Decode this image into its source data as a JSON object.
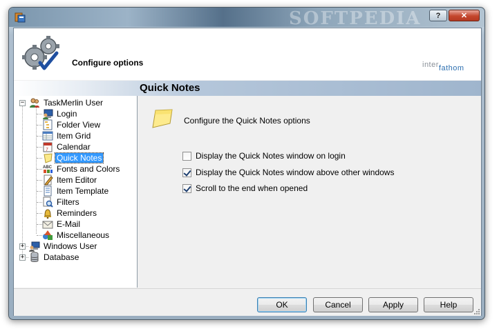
{
  "window": {
    "watermark": "SOFTPEDIA",
    "help_glyph": "?",
    "close_glyph": "✕"
  },
  "header": {
    "title": "Configure options",
    "brand_part1": "inter",
    "brand_part2": "fathom"
  },
  "banner": {
    "title": "Quick Notes"
  },
  "tree": {
    "root": "TaskMerlin User",
    "children": [
      "Login",
      "Folder View",
      "Item Grid",
      "Calendar",
      "Quick Notes",
      "Fonts and Colors",
      "Item Editor",
      "Item Template",
      "Filters",
      "Reminders",
      "E-Mail",
      "Miscellaneous"
    ],
    "other_roots": [
      "Windows User",
      "Database"
    ],
    "selected": "Quick Notes"
  },
  "content": {
    "description": "Configure the Quick Notes options",
    "options": [
      {
        "label": "Display the Quick Notes window on login",
        "checked": false
      },
      {
        "label": "Display the Quick Notes window above other windows",
        "checked": true
      },
      {
        "label": "Scroll to the end when opened",
        "checked": true
      }
    ]
  },
  "footer": {
    "ok": "OK",
    "cancel": "Cancel",
    "apply": "Apply",
    "help": "Help"
  },
  "colors": {
    "selection": "#3399ff",
    "brand_blue": "#2c6fb0",
    "close_red": "#c4462d"
  }
}
